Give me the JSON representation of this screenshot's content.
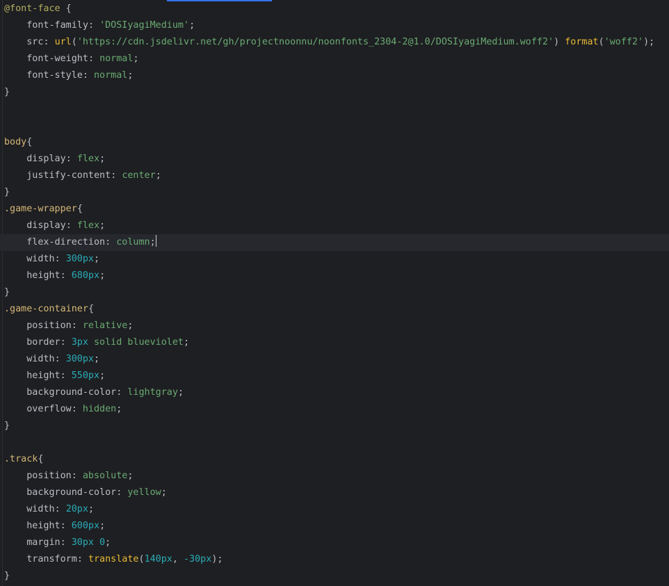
{
  "editor": {
    "colors": {
      "background": "#1e1f22",
      "current_line": "#26282e",
      "tab_indicator": "#3574f0",
      "at_rule": "#b3ae60",
      "selector": "#d5b778",
      "property": "#bcbec4",
      "string": "#6aab73",
      "number": "#2aacb8",
      "keyword_value": "#6aab73",
      "function": "#e8ba36"
    },
    "lines": [
      {
        "tokens": [
          {
            "t": "@font-face",
            "c": "t-at"
          },
          {
            "t": " {",
            "c": "t-punc"
          }
        ]
      },
      {
        "tokens": [
          {
            "t": "    font-family",
            "c": "t-prop"
          },
          {
            "t": ": ",
            "c": "t-punc"
          },
          {
            "t": "'DOSIyagiMedium'",
            "c": "t-str"
          },
          {
            "t": ";",
            "c": "t-punc"
          }
        ]
      },
      {
        "tokens": [
          {
            "t": "    src",
            "c": "t-prop"
          },
          {
            "t": ": ",
            "c": "t-punc"
          },
          {
            "t": "url",
            "c": "t-fn2"
          },
          {
            "t": "(",
            "c": "t-punc"
          },
          {
            "t": "'https://cdn.jsdelivr.net/gh/projectnoonnu/noonfonts_2304-2@1.0/DOSIyagiMedium.woff2'",
            "c": "t-str"
          },
          {
            "t": ") ",
            "c": "t-punc"
          },
          {
            "t": "format",
            "c": "t-fn2"
          },
          {
            "t": "(",
            "c": "t-punc"
          },
          {
            "t": "'woff2'",
            "c": "t-str"
          },
          {
            "t": ");",
            "c": "t-punc"
          }
        ]
      },
      {
        "tokens": [
          {
            "t": "    font-weight",
            "c": "t-prop"
          },
          {
            "t": ": ",
            "c": "t-punc"
          },
          {
            "t": "normal",
            "c": "t-kw"
          },
          {
            "t": ";",
            "c": "t-punc"
          }
        ]
      },
      {
        "tokens": [
          {
            "t": "    font-style",
            "c": "t-prop"
          },
          {
            "t": ": ",
            "c": "t-punc"
          },
          {
            "t": "normal",
            "c": "t-kw"
          },
          {
            "t": ";",
            "c": "t-punc"
          }
        ]
      },
      {
        "tokens": [
          {
            "t": "}",
            "c": "t-punc"
          }
        ]
      },
      {
        "tokens": []
      },
      {
        "tokens": []
      },
      {
        "tokens": [
          {
            "t": "body",
            "c": "t-sel"
          },
          {
            "t": "{",
            "c": "t-punc"
          }
        ]
      },
      {
        "tokens": [
          {
            "t": "    display",
            "c": "t-prop"
          },
          {
            "t": ": ",
            "c": "t-punc"
          },
          {
            "t": "flex",
            "c": "t-kw"
          },
          {
            "t": ";",
            "c": "t-punc"
          }
        ]
      },
      {
        "tokens": [
          {
            "t": "    justify-content",
            "c": "t-prop"
          },
          {
            "t": ": ",
            "c": "t-punc"
          },
          {
            "t": "center",
            "c": "t-kw"
          },
          {
            "t": ";",
            "c": "t-punc"
          }
        ]
      },
      {
        "tokens": [
          {
            "t": "}",
            "c": "t-punc"
          }
        ]
      },
      {
        "tokens": [
          {
            "t": ".game-wrapper",
            "c": "t-sel"
          },
          {
            "t": "{",
            "c": "t-punc"
          }
        ]
      },
      {
        "tokens": [
          {
            "t": "    display",
            "c": "t-prop"
          },
          {
            "t": ": ",
            "c": "t-punc"
          },
          {
            "t": "flex",
            "c": "t-kw"
          },
          {
            "t": ";",
            "c": "t-punc"
          }
        ]
      },
      {
        "current": true,
        "caret_after": true,
        "tokens": [
          {
            "t": "    flex-direction",
            "c": "t-prop"
          },
          {
            "t": ": ",
            "c": "t-punc"
          },
          {
            "t": "column",
            "c": "t-kw"
          },
          {
            "t": ";",
            "c": "t-punc"
          }
        ]
      },
      {
        "tokens": [
          {
            "t": "    width",
            "c": "t-prop"
          },
          {
            "t": ": ",
            "c": "t-punc"
          },
          {
            "t": "300px",
            "c": "t-num"
          },
          {
            "t": ";",
            "c": "t-punc"
          }
        ]
      },
      {
        "tokens": [
          {
            "t": "    height",
            "c": "t-prop"
          },
          {
            "t": ": ",
            "c": "t-punc"
          },
          {
            "t": "680px",
            "c": "t-num"
          },
          {
            "t": ";",
            "c": "t-punc"
          }
        ]
      },
      {
        "tokens": [
          {
            "t": "}",
            "c": "t-punc"
          }
        ]
      },
      {
        "tokens": [
          {
            "t": ".game-container",
            "c": "t-sel"
          },
          {
            "t": "{",
            "c": "t-punc"
          }
        ]
      },
      {
        "tokens": [
          {
            "t": "    position",
            "c": "t-prop"
          },
          {
            "t": ": ",
            "c": "t-punc"
          },
          {
            "t": "relative",
            "c": "t-kw"
          },
          {
            "t": ";",
            "c": "t-punc"
          }
        ]
      },
      {
        "tokens": [
          {
            "t": "    border",
            "c": "t-prop"
          },
          {
            "t": ": ",
            "c": "t-punc"
          },
          {
            "t": "3px",
            "c": "t-num"
          },
          {
            "t": " solid blueviolet",
            "c": "t-kw"
          },
          {
            "t": ";",
            "c": "t-punc"
          }
        ]
      },
      {
        "tokens": [
          {
            "t": "    width",
            "c": "t-prop"
          },
          {
            "t": ": ",
            "c": "t-punc"
          },
          {
            "t": "300px",
            "c": "t-num"
          },
          {
            "t": ";",
            "c": "t-punc"
          }
        ]
      },
      {
        "tokens": [
          {
            "t": "    height",
            "c": "t-prop"
          },
          {
            "t": ": ",
            "c": "t-punc"
          },
          {
            "t": "550px",
            "c": "t-num"
          },
          {
            "t": ";",
            "c": "t-punc"
          }
        ]
      },
      {
        "tokens": [
          {
            "t": "    background-color",
            "c": "t-prop"
          },
          {
            "t": ": ",
            "c": "t-punc"
          },
          {
            "t": "lightgray",
            "c": "t-kw"
          },
          {
            "t": ";",
            "c": "t-punc"
          }
        ]
      },
      {
        "tokens": [
          {
            "t": "    overflow",
            "c": "t-prop"
          },
          {
            "t": ": ",
            "c": "t-punc"
          },
          {
            "t": "hidden",
            "c": "t-kw"
          },
          {
            "t": ";",
            "c": "t-punc"
          }
        ]
      },
      {
        "tokens": [
          {
            "t": "}",
            "c": "t-punc"
          }
        ]
      },
      {
        "tokens": []
      },
      {
        "tokens": [
          {
            "t": ".track",
            "c": "t-sel"
          },
          {
            "t": "{",
            "c": "t-punc"
          }
        ]
      },
      {
        "tokens": [
          {
            "t": "    position",
            "c": "t-prop"
          },
          {
            "t": ": ",
            "c": "t-punc"
          },
          {
            "t": "absolute",
            "c": "t-kw"
          },
          {
            "t": ";",
            "c": "t-punc"
          }
        ]
      },
      {
        "tokens": [
          {
            "t": "    background-color",
            "c": "t-prop"
          },
          {
            "t": ": ",
            "c": "t-punc"
          },
          {
            "t": "yellow",
            "c": "t-kw"
          },
          {
            "t": ";",
            "c": "t-punc"
          }
        ]
      },
      {
        "tokens": [
          {
            "t": "    width",
            "c": "t-prop"
          },
          {
            "t": ": ",
            "c": "t-punc"
          },
          {
            "t": "20px",
            "c": "t-num"
          },
          {
            "t": ";",
            "c": "t-punc"
          }
        ]
      },
      {
        "tokens": [
          {
            "t": "    height",
            "c": "t-prop"
          },
          {
            "t": ": ",
            "c": "t-punc"
          },
          {
            "t": "600px",
            "c": "t-num"
          },
          {
            "t": ";",
            "c": "t-punc"
          }
        ]
      },
      {
        "tokens": [
          {
            "t": "    margin",
            "c": "t-prop"
          },
          {
            "t": ": ",
            "c": "t-punc"
          },
          {
            "t": "30px 0",
            "c": "t-num"
          },
          {
            "t": ";",
            "c": "t-punc"
          }
        ]
      },
      {
        "tokens": [
          {
            "t": "    transform",
            "c": "t-prop"
          },
          {
            "t": ": ",
            "c": "t-punc"
          },
          {
            "t": "translate",
            "c": "t-fn2"
          },
          {
            "t": "(",
            "c": "t-punc"
          },
          {
            "t": "140px",
            "c": "t-num"
          },
          {
            "t": ", ",
            "c": "t-punc"
          },
          {
            "t": "-30px",
            "c": "t-num"
          },
          {
            "t": ");",
            "c": "t-punc"
          }
        ]
      },
      {
        "tokens": [
          {
            "t": "}",
            "c": "t-punc"
          }
        ]
      }
    ]
  }
}
